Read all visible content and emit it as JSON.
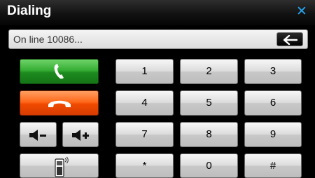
{
  "window": {
    "title": "Dialing",
    "close_glyph": "✕"
  },
  "display": {
    "text": "On line 10086..."
  },
  "icons": {
    "back": "left-arrow-icon",
    "call": "phone-call-icon",
    "end": "phone-hangup-icon",
    "vol_down": "volume-down-icon",
    "vol_up": "volume-up-icon",
    "dialpad": "mobile-keypad-icon"
  },
  "keypad": {
    "keys": [
      "1",
      "2",
      "3",
      "4",
      "5",
      "6",
      "7",
      "8",
      "9",
      "*",
      "0",
      "#"
    ]
  },
  "colors": {
    "close": "#26a4ee",
    "call": "#2a9e2a",
    "end": "#ff5a0e"
  }
}
